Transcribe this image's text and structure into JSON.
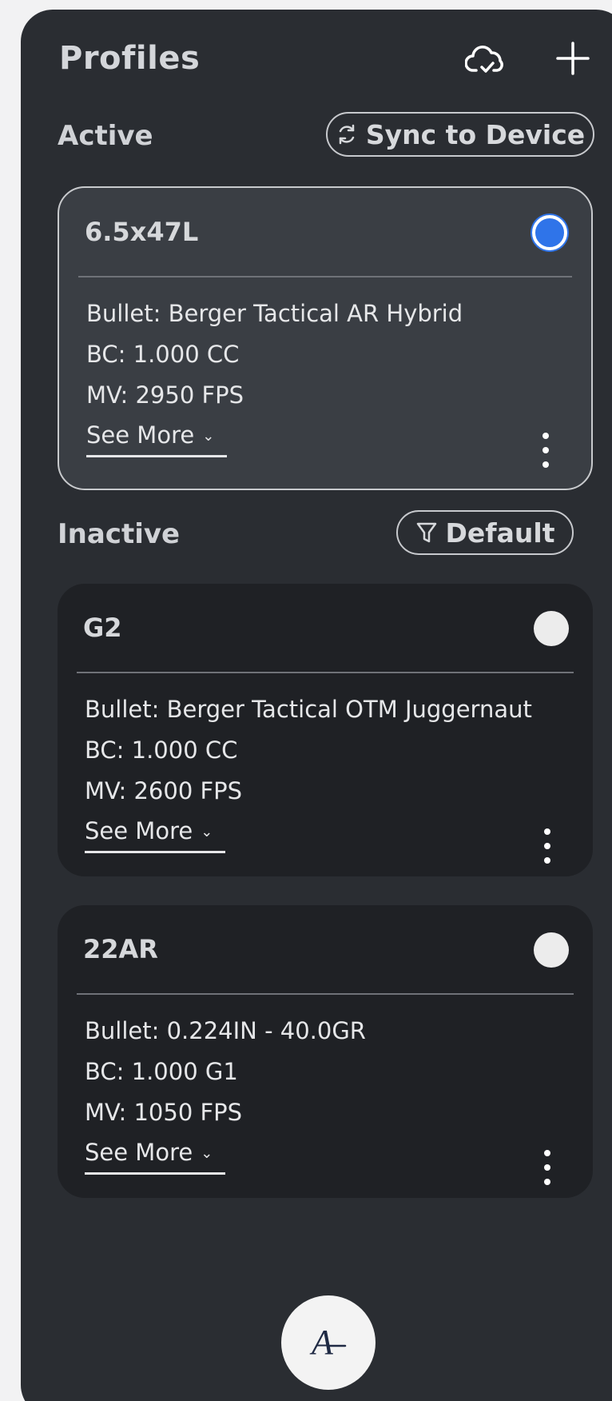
{
  "header": {
    "title": "Profiles",
    "cloud_icon": "cloud-check-icon",
    "add_icon": "plus-icon"
  },
  "active_section": {
    "label": "Active",
    "sync_button": {
      "label": "Sync to Device",
      "icon": "sync-icon"
    }
  },
  "inactive_section": {
    "label": "Inactive",
    "filter_button": {
      "label": "Default",
      "icon": "filter-icon"
    }
  },
  "profiles": [
    {
      "name": "6.5x47L",
      "selected": true,
      "bullet": "Bullet: Berger Tactical AR Hybrid",
      "bc": "BC: 1.000 CC",
      "mv": "MV: 2950 FPS",
      "see_more": "See More"
    },
    {
      "name": "G2",
      "selected": false,
      "bullet": "Bullet: Berger Tactical OTM Juggernaut",
      "bc": "BC: 1.000 CC",
      "mv": "MV: 2600 FPS",
      "see_more": "See More"
    },
    {
      "name": "22AR",
      "selected": false,
      "bullet": "Bullet: 0.224IN - 40.0GR",
      "bc": "BC: 1.000 G1",
      "mv": "MV: 1050 FPS",
      "see_more": "See More"
    }
  ],
  "fab": {
    "icon": "brand-logo-icon",
    "glyph": "A"
  },
  "colors": {
    "background": "#2a2d32",
    "active_card": "#3a3e44",
    "inactive_card": "#1f2125",
    "selected_radio": "#2f74e9"
  }
}
